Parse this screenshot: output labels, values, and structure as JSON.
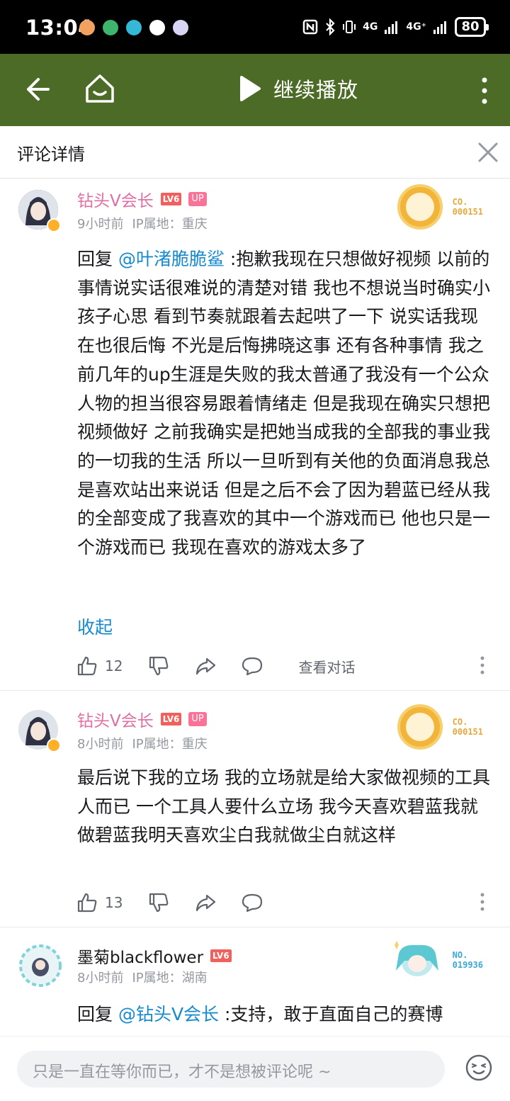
{
  "status": {
    "time": "13:04",
    "signal1": "4G",
    "signal2": "4G⁺",
    "battery": "80"
  },
  "appbar": {
    "play_label": "继续播放"
  },
  "header": {
    "title": "评论详情"
  },
  "comments": [
    {
      "user": "钻头V会长",
      "level": "LV6",
      "badge": "UP",
      "time": "9小时前",
      "ip": "IP属地：重庆",
      "deco_line1": "CO.",
      "deco_line2": "000151",
      "reply_prefix": "回复 ",
      "mention": "@叶渚脆脆鲨",
      "text": " :抱歉我现在只想做好视频 以前的事情说实话很难说的清楚对错 我也不想说当时确实小孩子心思 看到节奏就跟着去起哄了一下  说实话我现在也很后悔 不光是后悔拂晓这事 还有各种事情 我之前几年的up生涯是失败的我太普通了我没有一个公众人物的担当很容易跟着情绪走 但是我现在确实只想把视频做好 之前我确实是把她当成我的全部我的事业我的一切我的生活 所以一旦听到有关他的负面消息我总是喜欢站出来说话 但是之后不会了因为碧蓝已经从我的全部变成了我喜欢的其中一个游戏而已 他也只是一个游戏而已 我现在喜欢的游戏太多了",
      "collapse": "收起",
      "likes": "12",
      "view_convo": "查看对话"
    },
    {
      "user": "钻头V会长",
      "level": "LV6",
      "badge": "UP",
      "time": "8小时前",
      "ip": "IP属地：重庆",
      "deco_line1": "CO.",
      "deco_line2": "000151",
      "text": "最后说下我的立场 我的立场就是给大家做视频的工具人而已 一个工具人要什么立场 我今天喜欢碧蓝我就做碧蓝我明天喜欢尘白我就做尘白就这样",
      "likes": "13"
    },
    {
      "user": "墨菊blackflower",
      "level": "LV6",
      "time": "8小时前",
      "ip": "IP属地：湖南",
      "deco_line1": "NO.",
      "deco_line2": "019936",
      "reply_prefix": "回复 ",
      "mention": "@钻头V会长",
      "text": " :支持，敢于直面自己的赛博"
    }
  ],
  "input": {
    "placeholder": "只是一直在等你而已，才不是想被评论呢 ~"
  },
  "colors": {
    "appbar": "#4b6b27",
    "vip_name": "#e16fa4",
    "link": "#178bcf"
  }
}
